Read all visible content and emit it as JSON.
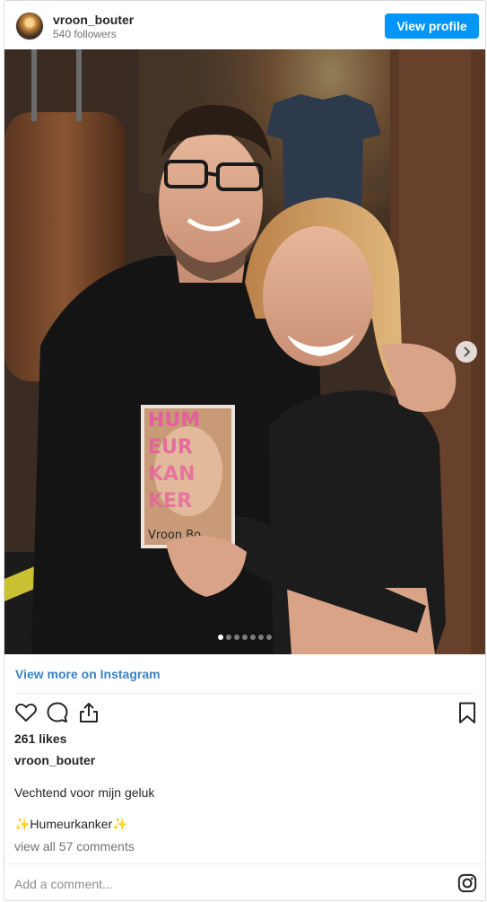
{
  "header": {
    "username": "vroon_bouter",
    "followers": "540 followers",
    "view_profile_label": "View profile"
  },
  "post": {
    "carousel": {
      "slide_count": 7,
      "current_slide": 1
    },
    "book_cover": {
      "title_letters": "HUM EUR KAN KER",
      "author": "Vroon Bo"
    }
  },
  "view_more_label": "View more on Instagram",
  "actions": {
    "like_icon": "heart-icon",
    "comment_icon": "comment-icon",
    "share_icon": "share-icon",
    "save_icon": "bookmark-icon"
  },
  "likes": "261 likes",
  "caption": {
    "username": "vroon_bouter",
    "line1": "Vechtend voor mijn geluk",
    "line2": "✨Humeurkanker✨"
  },
  "comments_link": "view all 57 comments",
  "comment_input": {
    "placeholder": "Add a comment..."
  },
  "colors": {
    "accent": "#0095f6",
    "link": "#3b82c4",
    "muted": "#737373",
    "border": "#dbdbdb"
  }
}
